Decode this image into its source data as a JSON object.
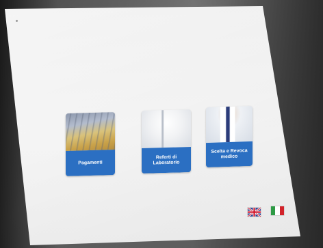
{
  "tiles": [
    {
      "id": "pagamenti",
      "label": "Pagamenti"
    },
    {
      "id": "referti",
      "label": "Referti di Laboratorio"
    },
    {
      "id": "scelta",
      "label": "Scelta e Revoca medico"
    }
  ],
  "languages": {
    "english": {
      "icon": "uk-flag-icon"
    },
    "italian": {
      "icon": "italy-flag-icon"
    }
  },
  "colors": {
    "tile_label_background": "#2b6fc2",
    "tile_label_text": "#ffffff",
    "screen_background": "#f2f2f2",
    "italy_green": "#2e9a45",
    "italy_white": "#ffffff",
    "italy_red": "#d2232a",
    "uk_blue": "#2a3f8f",
    "uk_red": "#cf142b"
  }
}
